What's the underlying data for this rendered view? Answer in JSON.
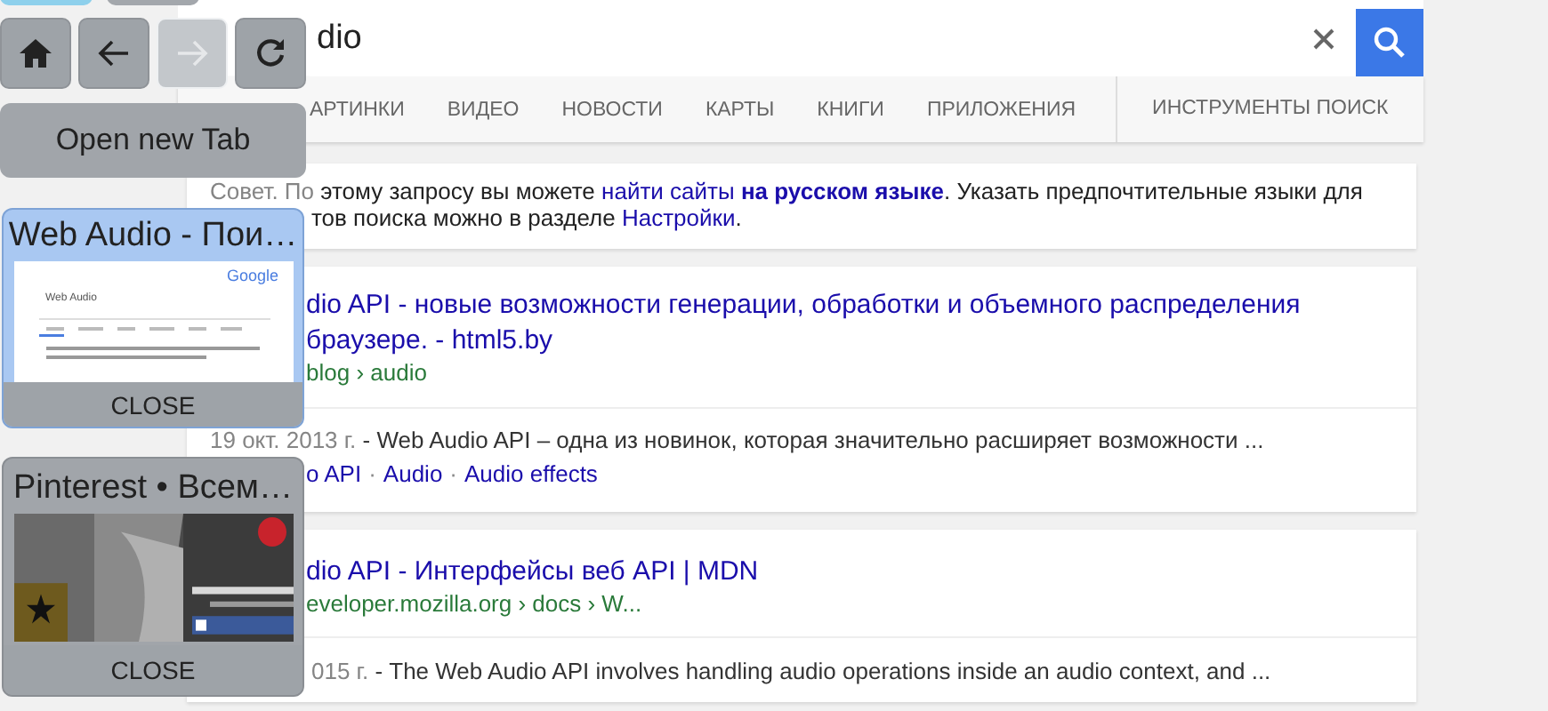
{
  "top_strip": [
    {
      "selected": true
    },
    {
      "selected": false
    }
  ],
  "nav_buttons": [
    {
      "kind": "home",
      "disabled": false
    },
    {
      "kind": "back",
      "disabled": false
    },
    {
      "kind": "forward",
      "disabled": true
    },
    {
      "kind": "reload",
      "disabled": false
    }
  ],
  "open_tab_label": "Open new Tab",
  "tab_cards": [
    {
      "title": "Web Audio - Пои…",
      "selected": true,
      "close_label": "CLOSE",
      "thumbnail": {
        "kind": "page",
        "logo": "Google",
        "query": "Web Audio"
      }
    },
    {
      "title": "Pinterest • Всем…",
      "selected": false,
      "close_label": "CLOSE"
    }
  ],
  "search": {
    "value": "dio"
  },
  "tabs": [
    "АРТИНКИ",
    "ВИДЕО",
    "НОВОСТИ",
    "КАРТЫ",
    "КНИГИ",
    "ПРИЛОЖЕНИЯ"
  ],
  "tools_label": "ИНСТРУМЕНТЫ ПОИСК",
  "hint": {
    "line_1": [
      {
        "kind": "muted",
        "text": "Совет. По"
      },
      {
        "kind": "text",
        "text": " этому запросу вы можете "
      },
      {
        "kind": "link",
        "text": "найти сайты"
      },
      {
        "kind": "strong_link",
        "text": "на русском языке"
      },
      {
        "kind": "text",
        "text": ". Указать предпочтительные языки для"
      }
    ],
    "line_2": [
      {
        "kind": "text",
        "text": "тов поиска можно в разделе "
      },
      {
        "kind": "link",
        "text": "Настройки"
      },
      {
        "kind": "text",
        "text": "."
      }
    ]
  },
  "results": [
    {
      "title_lines": [
        "dio API - новые возможности генерации, обработки и объемного распределения",
        "браузере. - html5.by"
      ],
      "url": "blog › audio",
      "date": "19 окт. 2013 г.",
      "snippet": " - Web Audio API – одна из новинок, которая значительно расширяет возможности ...",
      "links": [
        "o API",
        "Audio",
        "Audio effects"
      ],
      "link_separator": "·"
    },
    {
      "title_lines": [
        "dio API - Интерфейсы веб API | MDN"
      ],
      "url": "eveloper.mozilla.org › docs › W...",
      "date": "015 г.",
      "snippet": " - The Web Audio API involves handling audio operations inside an audio context, and ..."
    }
  ]
}
